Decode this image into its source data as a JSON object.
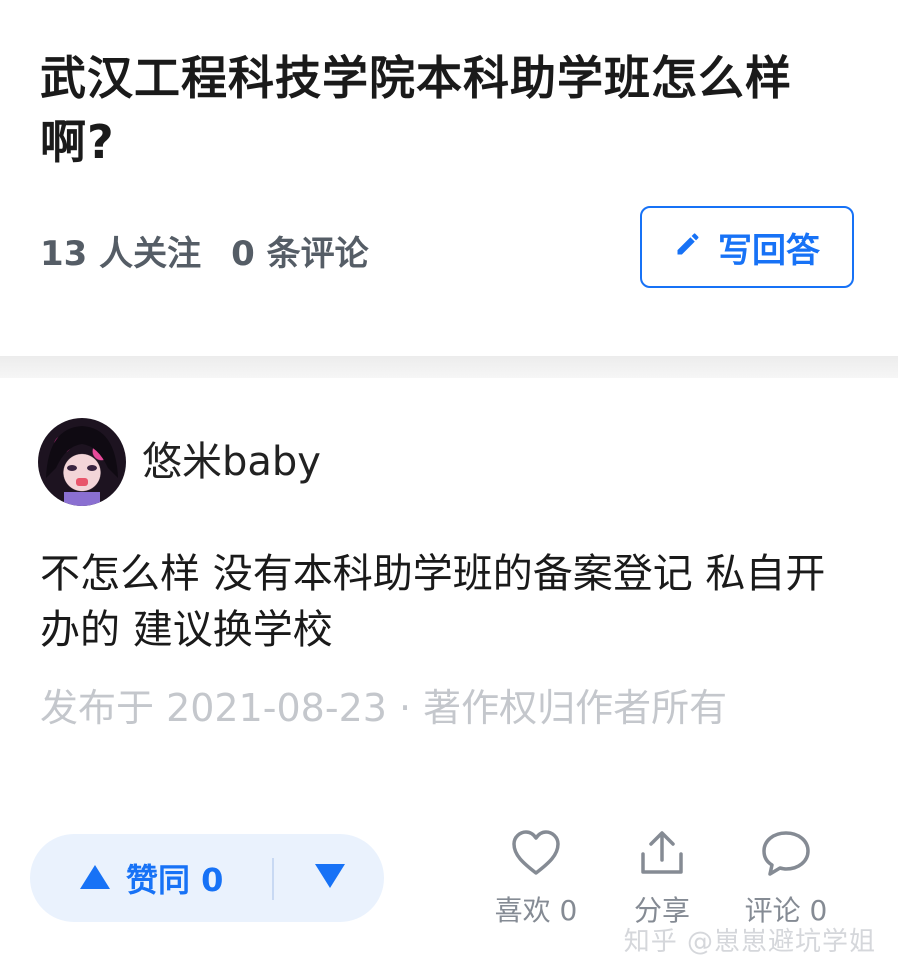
{
  "question": {
    "title": "武汉工程科技学院本科助学班怎么样啊?",
    "followers": "13 人关注",
    "comments": "0 条评论",
    "write_label": "写回答"
  },
  "answer": {
    "author": "悠米baby",
    "content": "不怎么样 没有本科助学班的备案登记 私自开办的 建议换学校",
    "pub_info": "发布于 2021-08-23 · 著作权归作者所有"
  },
  "actions": {
    "upvote_label": "赞同 0",
    "like_label": "喜欢 0",
    "share_label": "分享",
    "comment_label": "评论 0"
  },
  "watermark": "知乎 @崽崽避坑学姐",
  "colors": {
    "accent": "#1772f6",
    "muted": "#858b94",
    "vote_bg": "#eaf2fd"
  }
}
